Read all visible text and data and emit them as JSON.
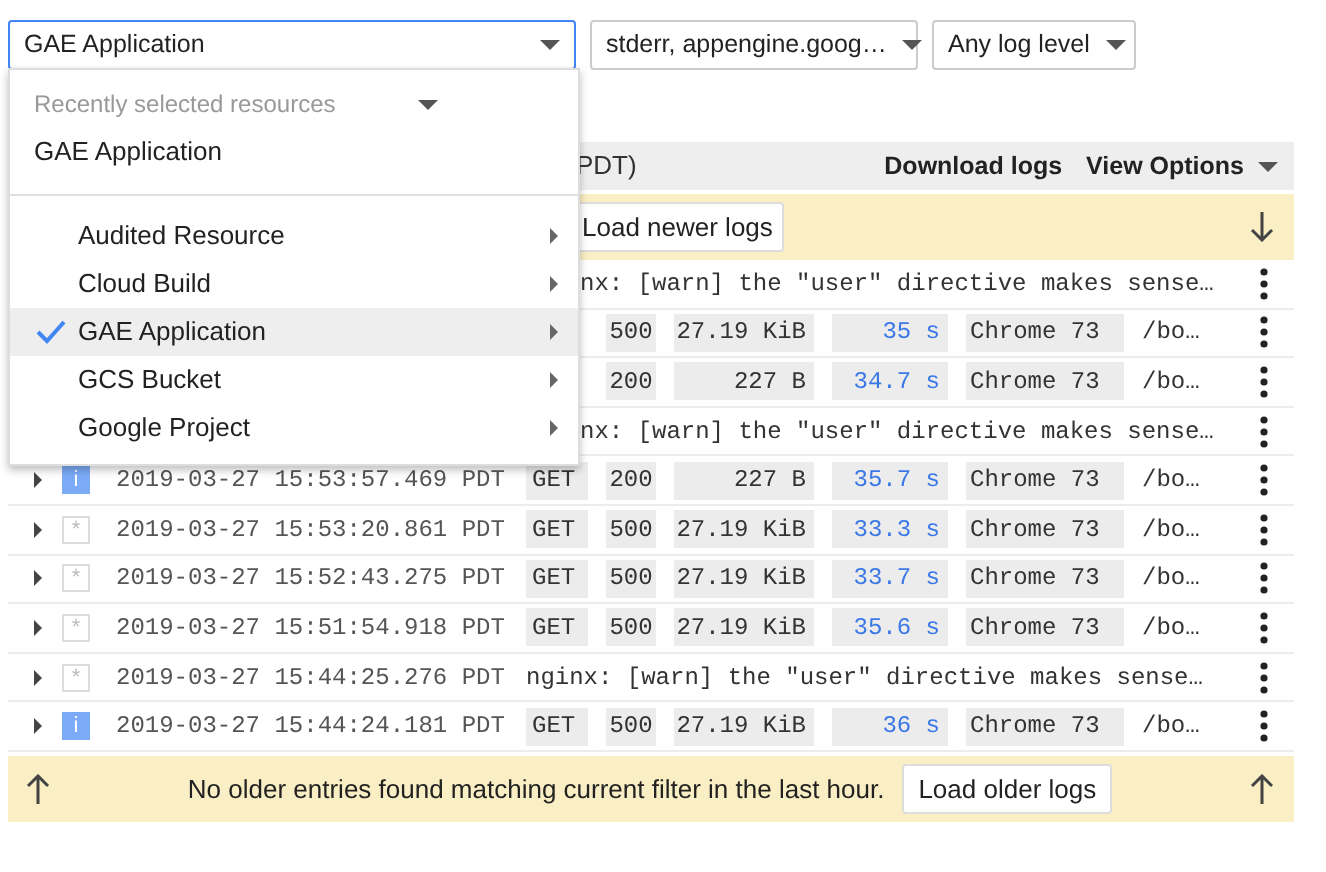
{
  "filters": [
    {
      "value": "GAE Application",
      "open": true
    },
    {
      "value": "stderr, appengine.goog…",
      "open": false
    },
    {
      "value": "Any log level",
      "open": false
    }
  ],
  "resource_menu": {
    "recent_heading": "Recently selected resources",
    "recent": [
      "GAE Application"
    ],
    "items": [
      {
        "label": "Audited Resource",
        "selected": false
      },
      {
        "label": "Cloud Build",
        "selected": false
      },
      {
        "label": "GAE Application",
        "selected": true
      },
      {
        "label": "GCS Bucket",
        "selected": false
      },
      {
        "label": "Google Project",
        "selected": false
      }
    ]
  },
  "toolbar": {
    "time_zone": "PDT)",
    "download": "Download logs",
    "view_options": "View Options"
  },
  "newer_bar": {
    "button": "Load newer logs"
  },
  "rows": [
    {
      "kind": "message",
      "message": "nx: [warn] the \"user\" directive makes sense…"
    },
    {
      "kind": "request",
      "status": "500",
      "size": "27.19 KiB",
      "latency": "35 s",
      "agent": "Chrome 73",
      "path": "/bo…"
    },
    {
      "kind": "request",
      "status": "200",
      "size": "227 B",
      "latency": "34.7 s",
      "agent": "Chrome 73",
      "path": "/bo…"
    },
    {
      "kind": "message",
      "message": "nx: [warn] the \"user\" directive makes sense…"
    },
    {
      "kind": "request",
      "info": true,
      "glyph": "i",
      "timestamp": "2019-03-27 15:53:57.469 PDT",
      "method": "GET",
      "status": "200",
      "size": "227 B",
      "latency": "35.7 s",
      "agent": "Chrome 73",
      "path": "/bo…"
    },
    {
      "kind": "request",
      "info": false,
      "glyph": "*",
      "timestamp": "2019-03-27 15:53:20.861 PDT",
      "method": "GET",
      "status": "500",
      "size": "27.19 KiB",
      "latency": "33.3 s",
      "agent": "Chrome 73",
      "path": "/bo…"
    },
    {
      "kind": "request",
      "info": false,
      "glyph": "*",
      "timestamp": "2019-03-27 15:52:43.275 PDT",
      "method": "GET",
      "status": "500",
      "size": "27.19 KiB",
      "latency": "33.7 s",
      "agent": "Chrome 73",
      "path": "/bo…"
    },
    {
      "kind": "request",
      "info": false,
      "glyph": "*",
      "timestamp": "2019-03-27 15:51:54.918 PDT",
      "method": "GET",
      "status": "500",
      "size": "27.19 KiB",
      "latency": "35.6 s",
      "agent": "Chrome 73",
      "path": "/bo…"
    },
    {
      "kind": "message",
      "info": false,
      "glyph": "*",
      "timestamp": "2019-03-27 15:44:25.276 PDT",
      "message": "nginx: [warn] the \"user\" directive makes sense…"
    },
    {
      "kind": "request",
      "info": true,
      "glyph": "i",
      "timestamp": "2019-03-27 15:44:24.181 PDT",
      "method": "GET",
      "status": "500",
      "size": "27.19 KiB",
      "latency": "36 s",
      "agent": "Chrome 73",
      "path": "/bo…"
    }
  ],
  "older_bar": {
    "message": "No older entries found matching current filter in the last hour.",
    "button": "Load older logs"
  }
}
